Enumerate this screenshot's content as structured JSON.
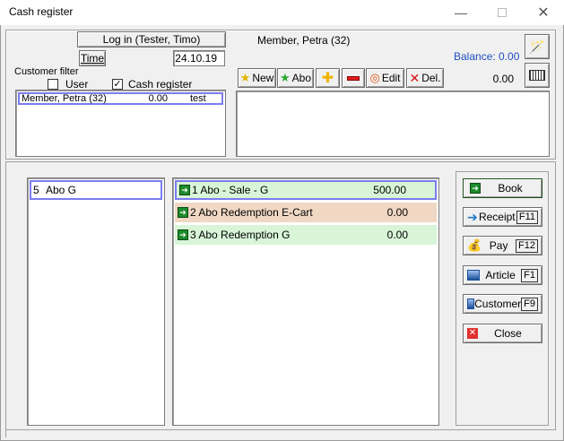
{
  "window": {
    "title": "Cash register"
  },
  "header": {
    "login_label": "Log in (Tester, Timo)",
    "time_label": "Time",
    "date_value": "24.10.19",
    "member_name": "Member, Petra (32)",
    "balance_label": "Balance: 0.00",
    "amount_value": "0.00"
  },
  "filter": {
    "title": "Customer filter",
    "user_label": "User",
    "user_checked": false,
    "cash_register_label": "Cash register",
    "cash_register_checked": true,
    "mark": "✓"
  },
  "customers": [
    {
      "name": "Member, Petra (32)",
      "amount": "0.00",
      "note": "test"
    }
  ],
  "toolbar": {
    "new_label": "New",
    "abo_label": "Abo",
    "edit_label": "Edit",
    "del_label": "Del."
  },
  "groups": [
    {
      "number": "5",
      "name": "Abo G"
    }
  ],
  "items": [
    {
      "label": "1 Abo - Sale - G",
      "value": "500.00",
      "bg": "#d8f5d8"
    },
    {
      "label": "2 Abo Redemption E-Cart",
      "value": "0.00",
      "bg": "#f0d8c4"
    },
    {
      "label": "3 Abo Redemption G",
      "value": "0.00",
      "bg": "#d8f5d8"
    }
  ],
  "side": {
    "book_label": "Book",
    "receipt_label": "Receipt",
    "receipt_key": "F11",
    "pay_label": "Pay",
    "pay_key": "F12",
    "article_label": "Article",
    "article_key": "F1",
    "customer_label": "Customer",
    "customer_key": "F9",
    "close_label": "Close"
  },
  "colors": {
    "balance": "#1f4fbf",
    "selection_border": "#7c7cf0"
  }
}
